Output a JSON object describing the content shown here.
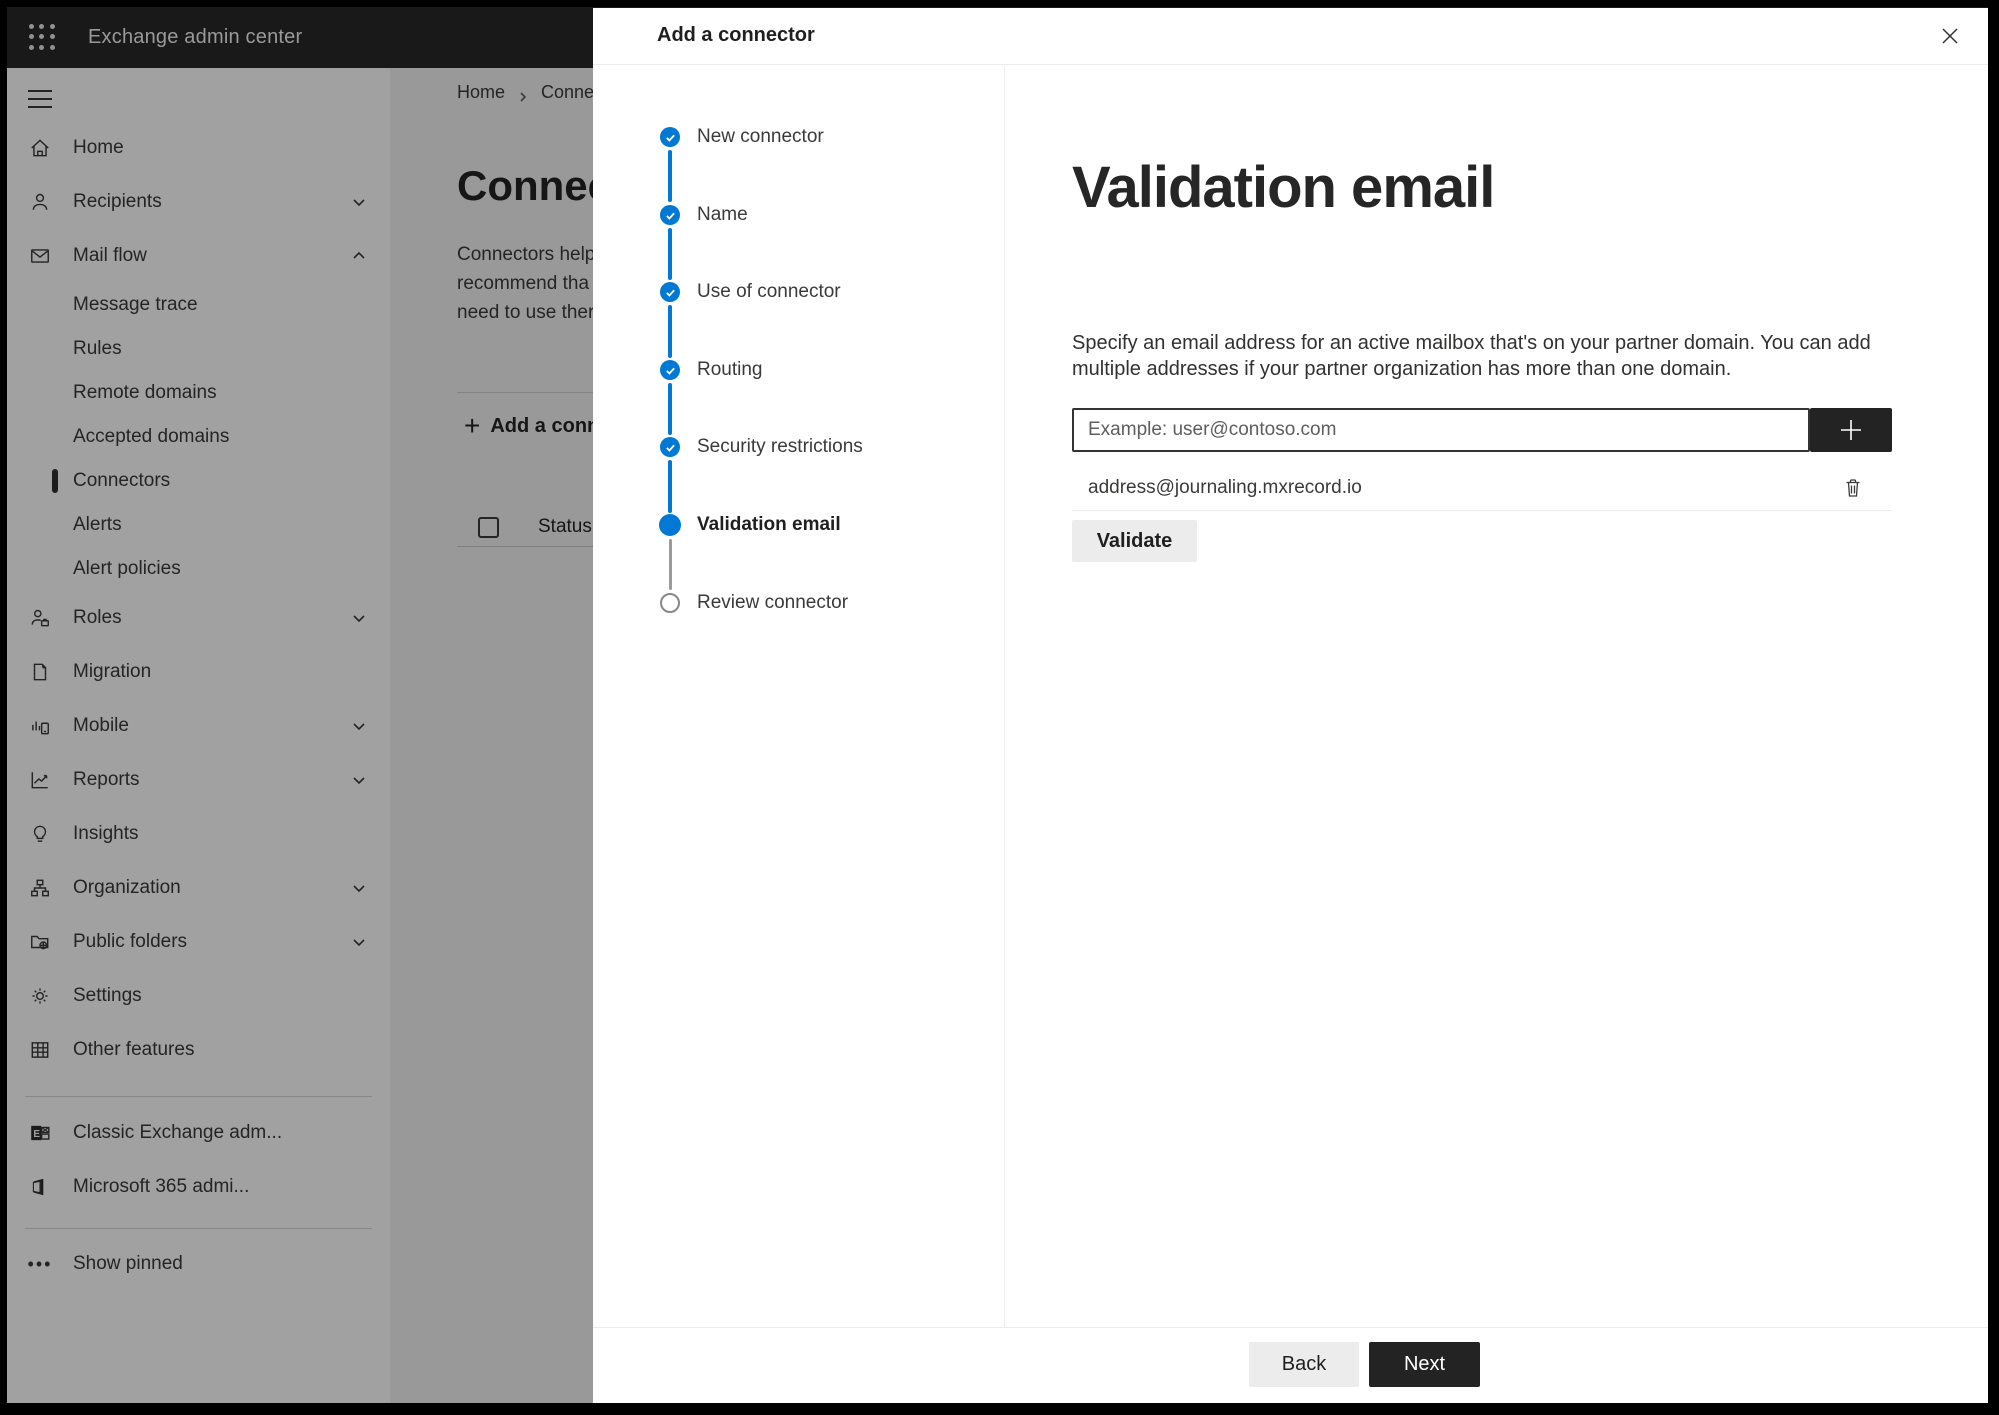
{
  "topbar": {
    "title": "Exchange admin center"
  },
  "sidebar": {
    "items": [
      {
        "label": "Home",
        "type": "main",
        "icon": "home-icon",
        "chevron": "none"
      },
      {
        "label": "Recipients",
        "type": "main",
        "icon": "person-icon",
        "chevron": "down"
      },
      {
        "label": "Mail flow",
        "type": "main",
        "icon": "envelope-icon",
        "chevron": "up"
      },
      {
        "label": "Message trace",
        "type": "sub",
        "icon": "",
        "chevron": "none"
      },
      {
        "label": "Rules",
        "type": "sub",
        "icon": "",
        "chevron": "none"
      },
      {
        "label": "Remote domains",
        "type": "sub",
        "icon": "",
        "chevron": "none"
      },
      {
        "label": "Accepted domains",
        "type": "sub",
        "icon": "",
        "chevron": "none"
      },
      {
        "label": "Connectors",
        "type": "sub",
        "icon": "",
        "chevron": "none",
        "selected": true
      },
      {
        "label": "Alerts",
        "type": "sub",
        "icon": "",
        "chevron": "none"
      },
      {
        "label": "Alert policies",
        "type": "sub",
        "icon": "",
        "chevron": "none"
      },
      {
        "label": "Roles",
        "type": "main",
        "icon": "person-briefcase-icon",
        "chevron": "down"
      },
      {
        "label": "Migration",
        "type": "main",
        "icon": "document-arrow-icon",
        "chevron": "none"
      },
      {
        "label": "Mobile",
        "type": "main",
        "icon": "mobile-chart-icon",
        "chevron": "down"
      },
      {
        "label": "Reports",
        "type": "main",
        "icon": "line-chart-icon",
        "chevron": "down"
      },
      {
        "label": "Insights",
        "type": "main",
        "icon": "lightbulb-icon",
        "chevron": "none"
      },
      {
        "label": "Organization",
        "type": "main",
        "icon": "org-tree-icon",
        "chevron": "down"
      },
      {
        "label": "Public folders",
        "type": "main",
        "icon": "folder-globe-icon",
        "chevron": "down"
      },
      {
        "label": "Settings",
        "type": "main",
        "icon": "gear-icon",
        "chevron": "none"
      },
      {
        "label": "Other features",
        "type": "main",
        "icon": "grid-table-icon",
        "chevron": "none"
      }
    ],
    "footer_items": [
      {
        "label": "Classic Exchange adm...",
        "icon": "classic-exchange-icon"
      },
      {
        "label": "Microsoft 365 admi...",
        "icon": "microsoft-365-icon"
      }
    ],
    "show_pinned": "Show pinned"
  },
  "page": {
    "breadcrumb": {
      "home": "Home",
      "current": "Conne"
    },
    "title": "Connec",
    "intro_lines": [
      "Connectors help",
      "recommend tha",
      "need to use ther"
    ],
    "add_button_label": "Add a conn",
    "status_column": "Status"
  },
  "dialog": {
    "title": "Add a connector",
    "steps": [
      {
        "label": "New connector",
        "state": "done"
      },
      {
        "label": "Name",
        "state": "done"
      },
      {
        "label": "Use of connector",
        "state": "done"
      },
      {
        "label": "Routing",
        "state": "done"
      },
      {
        "label": "Security restrictions",
        "state": "done"
      },
      {
        "label": "Validation email",
        "state": "current"
      },
      {
        "label": "Review connector",
        "state": "todo"
      }
    ],
    "heading": "Validation email",
    "description": "Specify an email address for an active mailbox that's on your partner domain. You can add multiple addresses if your partner organization has more than one domain.",
    "email_input_placeholder": "Example: user@contoso.com",
    "added_address": "address@journaling.mxrecord.io",
    "validate_label": "Validate",
    "back_label": "Back",
    "next_label": "Next"
  },
  "colors": {
    "accent": "#0078d4",
    "step_pending_border": "#8a8886",
    "dialog_primary_button": "#232323",
    "topbar_background": "#282828"
  }
}
